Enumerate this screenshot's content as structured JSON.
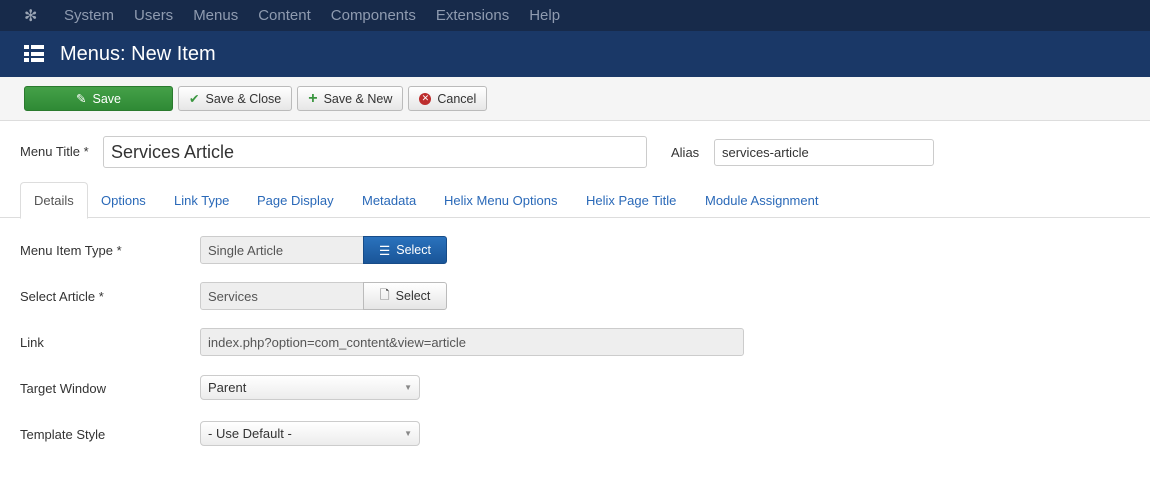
{
  "topnav": {
    "items": [
      "System",
      "Users",
      "Menus",
      "Content",
      "Components",
      "Extensions",
      "Help"
    ]
  },
  "header": {
    "title": "Menus: New Item"
  },
  "toolbar": {
    "save": "Save",
    "save_close": "Save & Close",
    "save_new": "Save & New",
    "cancel": "Cancel"
  },
  "form": {
    "menu_title_label": "Menu Title *",
    "menu_title_value": "Services Article",
    "alias_label": "Alias",
    "alias_value": "services-article"
  },
  "tabs": [
    "Details",
    "Options",
    "Link Type",
    "Page Display",
    "Metadata",
    "Helix Menu Options",
    "Helix Page Title",
    "Module Assignment"
  ],
  "details": {
    "menu_item_type_label": "Menu Item Type *",
    "menu_item_type_value": "Single Article",
    "select_label": "Select",
    "select_article_label": "Select Article *",
    "select_article_value": "Services",
    "link_label": "Link",
    "link_value": "index.php?option=com_content&view=article",
    "target_window_label": "Target Window",
    "target_window_value": "Parent",
    "template_style_label": "Template Style",
    "template_style_value": "- Use Default -"
  },
  "colors": {
    "topnav": "#172a4a",
    "header": "#1a3867",
    "save": "#3a963f",
    "primary": "#1d5fa8",
    "link": "#2a69b8"
  }
}
